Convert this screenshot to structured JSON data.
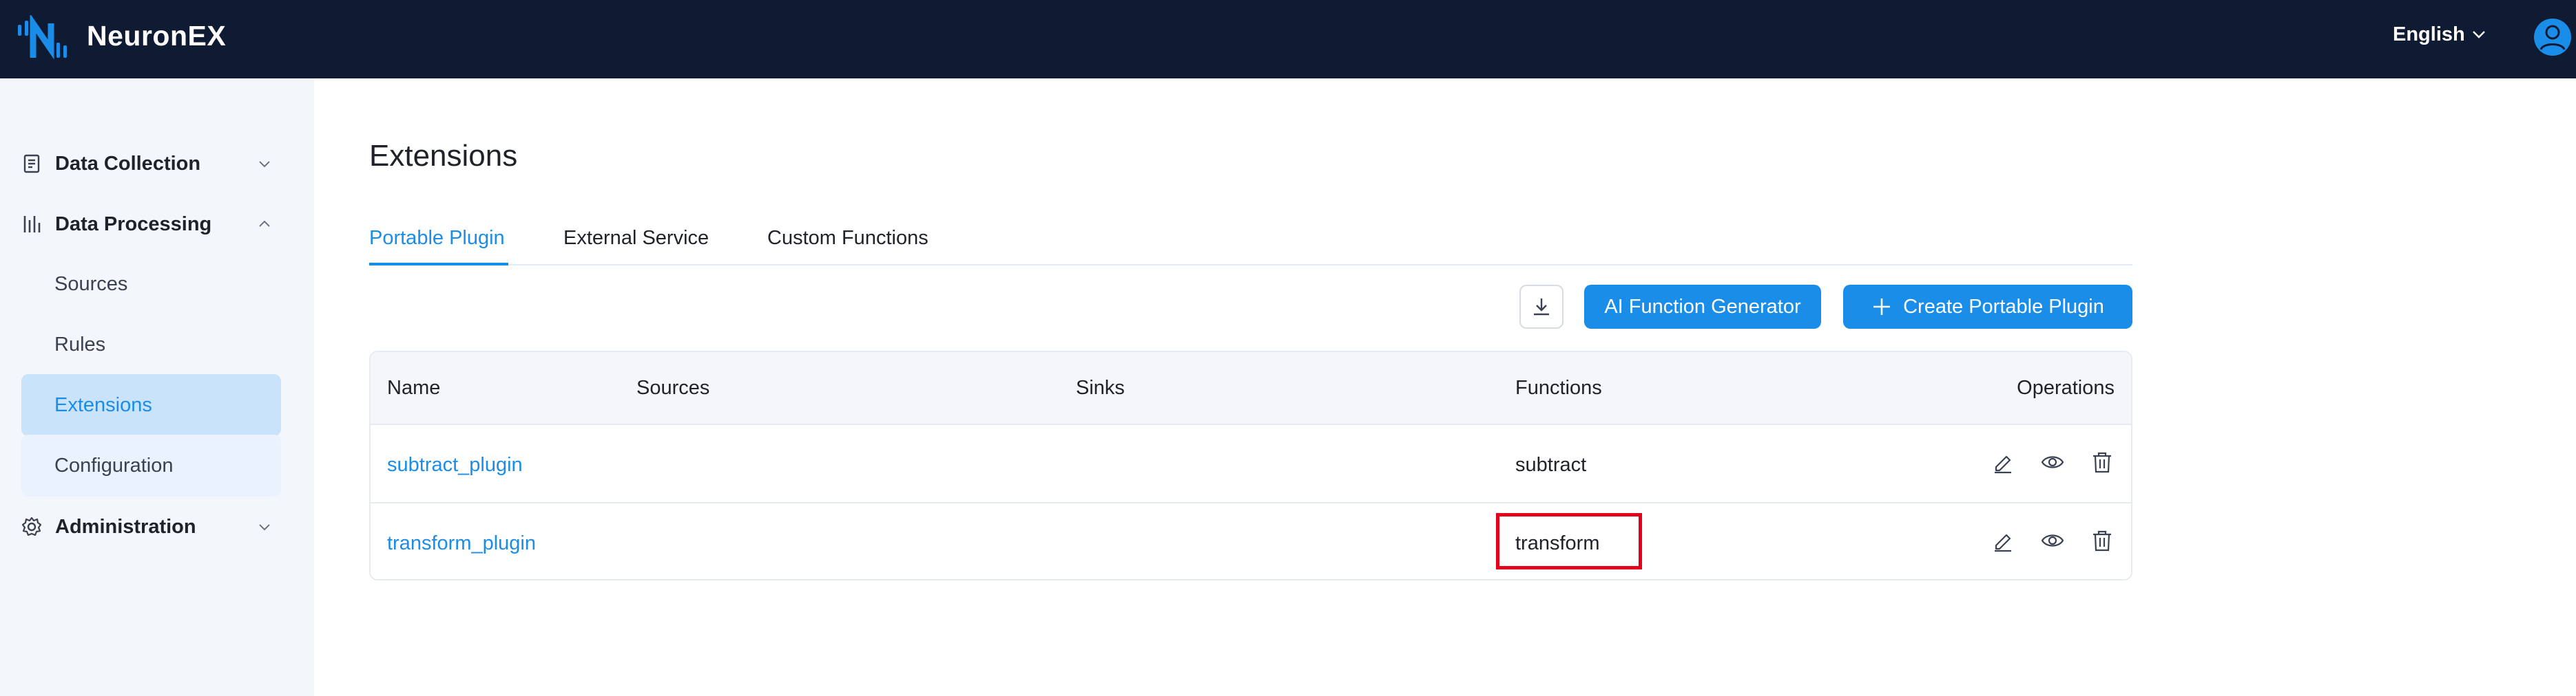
{
  "header": {
    "brand": "NeuronEX",
    "language": "English",
    "colors": {
      "bg": "#0f1a33",
      "accent": "#1a8de8"
    }
  },
  "sidebar": {
    "groups": [
      {
        "label": "Data Collection",
        "icon": "data-collection-icon",
        "expanded": false
      },
      {
        "label": "Data Processing",
        "icon": "data-processing-icon",
        "expanded": true
      },
      {
        "label": "Administration",
        "icon": "gear-icon",
        "expanded": false
      }
    ],
    "items": [
      {
        "label": "Sources"
      },
      {
        "label": "Rules"
      },
      {
        "label": "Extensions",
        "active": true
      },
      {
        "label": "Configuration"
      }
    ]
  },
  "main": {
    "title": "Extensions",
    "tabs": [
      {
        "label": "Portable Plugin",
        "active": true
      },
      {
        "label": "External Service"
      },
      {
        "label": "Custom Functions"
      }
    ],
    "actions": {
      "ai_label": "AI Function Generator",
      "create_label": "Create Portable Plugin"
    },
    "table": {
      "columns": [
        "Name",
        "Sources",
        "Sinks",
        "Functions",
        "Operations"
      ],
      "rows": [
        {
          "name": "subtract_plugin",
          "sources": "",
          "sinks": "",
          "functions": "subtract"
        },
        {
          "name": "transform_plugin",
          "sources": "",
          "sinks": "",
          "functions": "transform"
        }
      ]
    }
  }
}
